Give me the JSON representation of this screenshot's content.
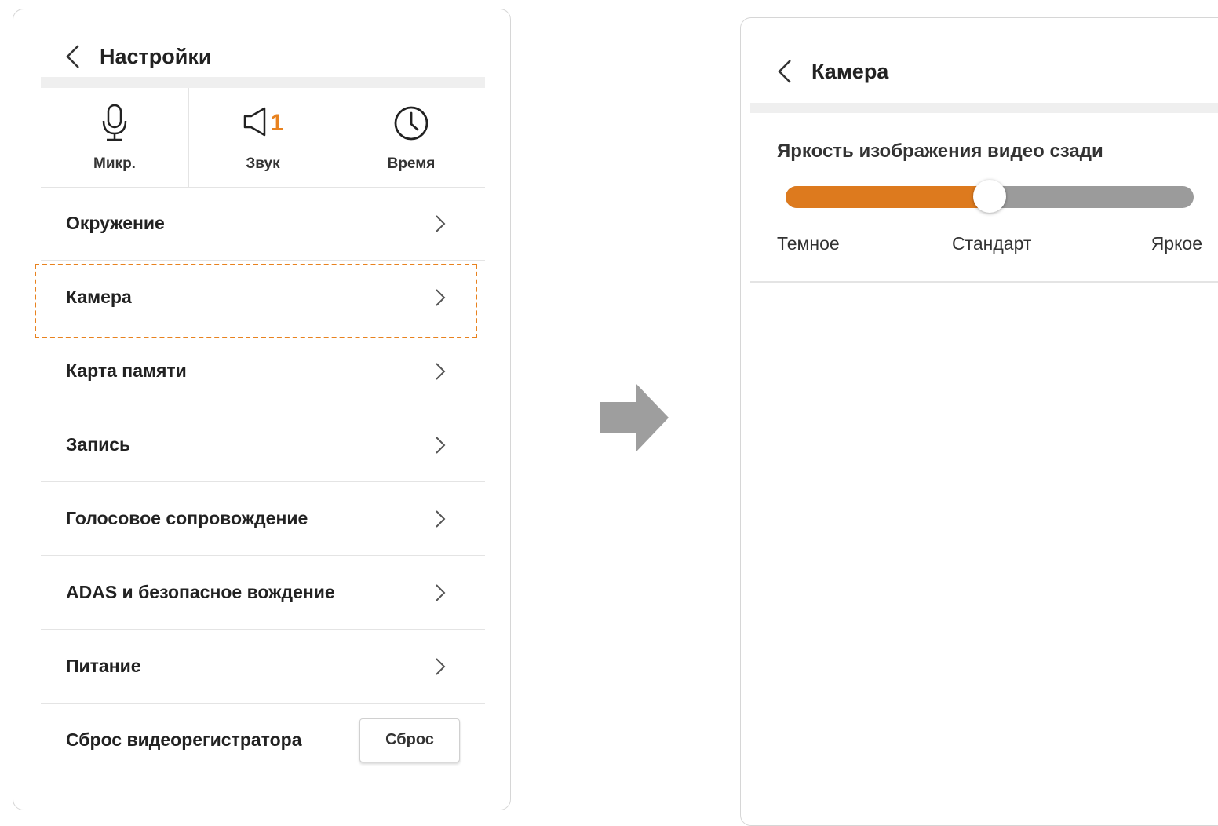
{
  "left_screen": {
    "title": "Настройки",
    "quick_items": [
      {
        "icon": "microphone-icon",
        "label": "Микр."
      },
      {
        "icon": "speaker-icon",
        "label": "Звук",
        "badge": "1"
      },
      {
        "icon": "clock-icon",
        "label": "Время"
      }
    ],
    "menu": [
      {
        "label": "Окружение"
      },
      {
        "label": "Камера",
        "highlighted": true
      },
      {
        "label": "Карта памяти"
      },
      {
        "label": "Запись"
      },
      {
        "label": "Голосовое сопровождение"
      },
      {
        "label": "ADAS и безопасное вождение"
      },
      {
        "label": "Питание"
      },
      {
        "label": "Сброс видеорегистратора",
        "button": "Сброс"
      }
    ]
  },
  "right_screen": {
    "title": "Камера",
    "setting": {
      "label": "Яркость изображения видео сзади",
      "level": 0.5,
      "scale_labels": [
        "Темное",
        "Стандарт",
        "Яркое"
      ]
    }
  },
  "colors": {
    "accent": "#dd7a1e",
    "highlight_border": "#e8821f",
    "track": "#9b9b9b",
    "arrow": "#9e9e9e"
  }
}
